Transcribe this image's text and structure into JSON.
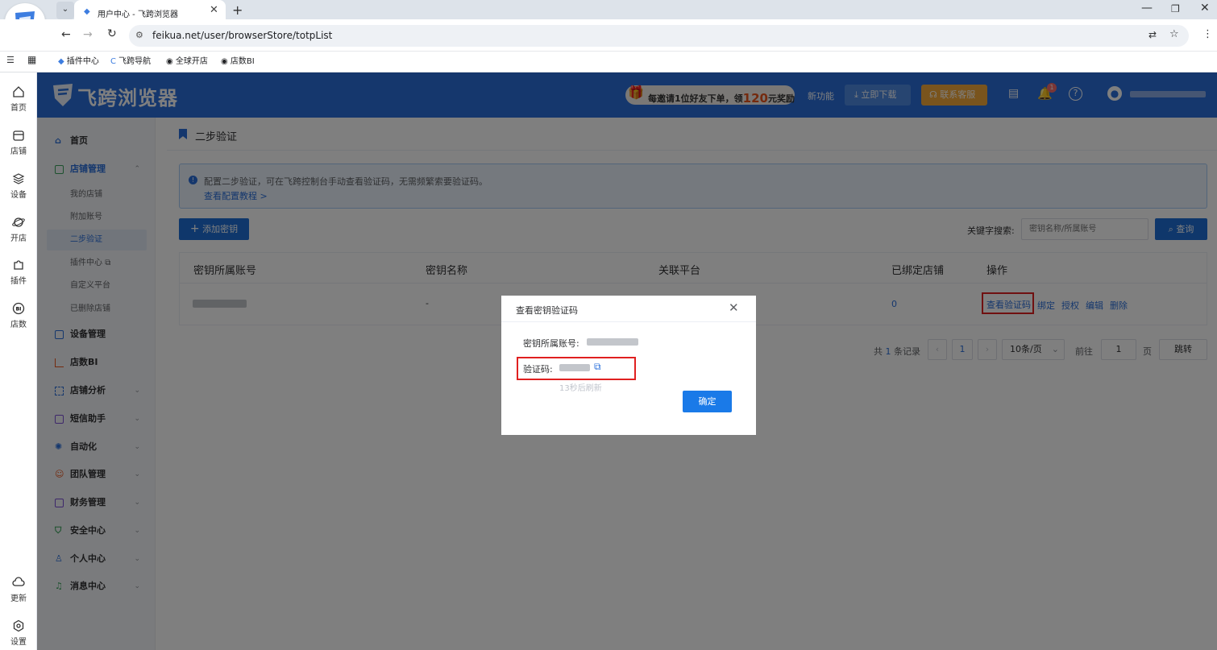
{
  "browser": {
    "tab_title": "用户中心 - 飞跨浏览器",
    "url": "feikua.net/user/browserStore/totpList",
    "bookmarks": [
      "插件中心",
      "飞跨导航",
      "全球开店",
      "店数BI"
    ]
  },
  "rail": [
    "首页",
    "店铺",
    "设备",
    "开店",
    "插件",
    "店数",
    "更新",
    "设置"
  ],
  "header": {
    "logo": "飞跨浏览器",
    "promo_prefix": "每邀请1位好友下单，领",
    "promo_amount": "120",
    "promo_suffix": "元奖励",
    "new_feature": "新功能",
    "download": "立即下载",
    "service": "联系客服",
    "notification_count": "1"
  },
  "sidebar": {
    "home": "首页",
    "store_mgmt": "店铺管理",
    "sub": [
      "我的店铺",
      "附加账号",
      "二步验证",
      "插件中心",
      "自定义平台",
      "已删除店铺"
    ],
    "groups": [
      "设备管理",
      "店数BI",
      "店铺分析",
      "短信助手",
      "自动化",
      "团队管理",
      "财务管理",
      "安全中心",
      "个人中心",
      "消息中心"
    ]
  },
  "page": {
    "title": "二步验证",
    "notice": "配置二步验证，可在飞跨控制台手动查看验证码，无需频繁索要验证码。",
    "notice_link": "查看配置教程 >",
    "add_button": "添加密钥",
    "search_label": "关键字搜索:",
    "search_placeholder": "密钥名称/所属账号",
    "search_button": "查询",
    "columns": [
      "密钥所属账号",
      "密钥名称",
      "关联平台",
      "已绑定店铺",
      "操作"
    ],
    "row": {
      "name": "-",
      "bound": "0"
    },
    "actions": [
      "查看验证码",
      "绑定",
      "授权",
      "编辑",
      "删除"
    ],
    "pagination": {
      "total_prefix": "共",
      "total": "1",
      "total_suffix": "条记录",
      "page": "1",
      "page_size": "10条/页",
      "goto": "前往",
      "goto_value": "1",
      "page_unit": "页",
      "jump": "跳转"
    }
  },
  "dialog": {
    "title": "查看密钥验证码",
    "account_label": "密钥所属账号:",
    "code_label": "验证码:",
    "refresh": "13秒后刷新",
    "confirm": "确定"
  },
  "colors": {
    "primary": "#2a6fdb",
    "highlight": "#e02020",
    "promo": "#e8541c"
  }
}
